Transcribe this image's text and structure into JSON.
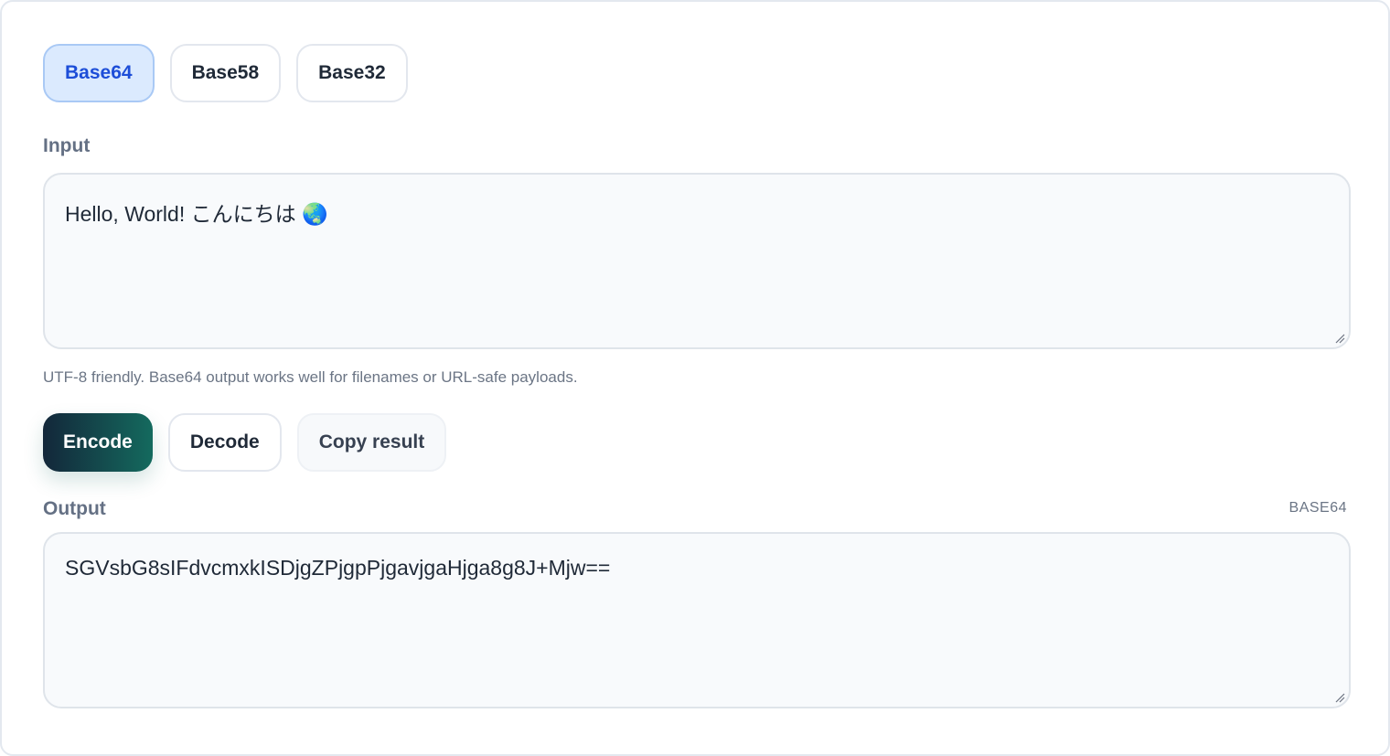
{
  "encoding_tabs": [
    {
      "label": "Base64",
      "active": true
    },
    {
      "label": "Base58",
      "active": false
    },
    {
      "label": "Base32",
      "active": false
    }
  ],
  "input": {
    "label": "Input",
    "value": "Hello, World! こんにちは 🌏",
    "hint": "UTF-8 friendly. Base64 output works well for filenames or URL-safe payloads."
  },
  "actions": {
    "encode_label": "Encode",
    "decode_label": "Decode",
    "copy_label": "Copy result"
  },
  "output": {
    "label": "Output",
    "format_tag": "BASE64",
    "value": "SGVsbG8sIFdvcmxkISDjgZPjgpPjgavjgaHjga8g8J+Mjw=="
  },
  "colors": {
    "active_tab_bg": "#dbeafe",
    "active_tab_text": "#1d4ed8",
    "primary_gradient_start": "#13273a",
    "primary_gradient_end": "#146a5e"
  }
}
